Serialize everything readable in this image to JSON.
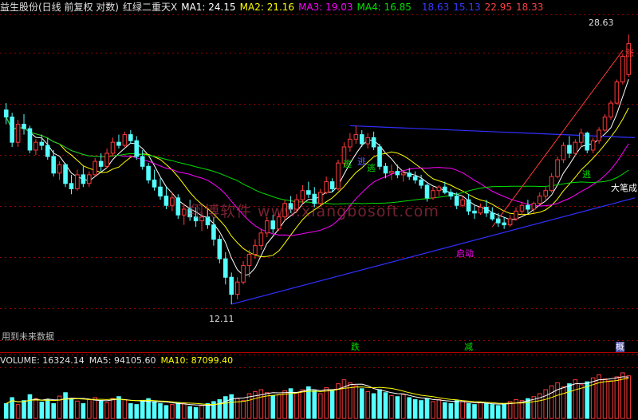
{
  "header": {
    "title": "益生股份(日线 前复权 对数)",
    "indicator": "红绿二重天X",
    "ma1": "MA1: 24.15",
    "ma2": "MA2: 21.16",
    "ma3": "MA3: 19.03",
    "ma4": "MA4: 16.85",
    "v1": "18.63",
    "v2": "15.13",
    "v3": "22.95",
    "v4": "18.33"
  },
  "colors": {
    "background": "#000000",
    "up": "#ff3a3a",
    "down": "#54ffff",
    "ma1": "#ffffff",
    "ma2": "#ffff00",
    "ma3": "#ff00ff",
    "ma4": "#00e000",
    "trendline": "#3030ff",
    "grid": "#9a0000"
  },
  "price_panel": {
    "high_label": "28.63",
    "low_label": "12.11",
    "rise_tag": "涨",
    "future_data_note": "用到未来数据",
    "annotations": [
      "逃",
      "逃",
      "逃",
      "启动",
      "逃",
      "大笔成"
    ]
  },
  "signal_row": {
    "fall": "跌",
    "reduce": "减",
    "right": "概"
  },
  "volume_header": {
    "volume": "VOLUME: 16324.14",
    "ma5": "MA5: 94105.60",
    "ma10": "MA10: 87099.40"
  },
  "watermark": "翔博软件 www.xiangbosoft.com",
  "chart_data": {
    "type": "candlestick",
    "price_range": [
      12.11,
      28.63
    ],
    "candles": [
      [
        22.5,
        23.0,
        21.5,
        22.0
      ],
      [
        22.0,
        22.3,
        20.0,
        20.3
      ],
      [
        20.3,
        21.8,
        20.0,
        21.5
      ],
      [
        21.5,
        22.2,
        20.8,
        21.2
      ],
      [
        21.2,
        21.4,
        19.6,
        19.8
      ],
      [
        19.8,
        20.5,
        19.5,
        20.3
      ],
      [
        20.3,
        20.8,
        19.8,
        20.1
      ],
      [
        20.1,
        20.6,
        19.2,
        19.4
      ],
      [
        19.4,
        19.8,
        18.2,
        18.4
      ],
      [
        18.4,
        19.1,
        18.0,
        18.9
      ],
      [
        18.9,
        19.0,
        17.6,
        17.8
      ],
      [
        17.8,
        18.3,
        17.2,
        17.5
      ],
      [
        17.5,
        18.6,
        17.4,
        18.3
      ],
      [
        18.3,
        18.8,
        17.6,
        17.8
      ],
      [
        17.8,
        18.5,
        17.6,
        18.3
      ],
      [
        18.3,
        19.3,
        18.2,
        19.1
      ],
      [
        19.1,
        19.6,
        18.5,
        18.8
      ],
      [
        18.8,
        19.9,
        18.7,
        19.6
      ],
      [
        19.6,
        20.6,
        19.4,
        20.3
      ],
      [
        20.3,
        20.8,
        19.9,
        20.1
      ],
      [
        20.1,
        21.0,
        20.0,
        20.8
      ],
      [
        20.8,
        21.1,
        20.2,
        20.4
      ],
      [
        20.4,
        20.7,
        19.2,
        19.4
      ],
      [
        19.4,
        19.8,
        18.6,
        18.8
      ],
      [
        18.8,
        19.0,
        17.8,
        18.0
      ],
      [
        18.0,
        18.6,
        17.4,
        17.6
      ],
      [
        17.6,
        18.1,
        16.9,
        17.1
      ],
      [
        17.1,
        17.6,
        16.4,
        16.6
      ],
      [
        16.6,
        17.3,
        16.3,
        17.0
      ],
      [
        17.0,
        17.2,
        15.9,
        16.1
      ],
      [
        16.1,
        16.7,
        15.6,
        16.4
      ],
      [
        16.4,
        16.9,
        15.8,
        16.0
      ],
      [
        16.0,
        16.5,
        15.5,
        15.8
      ],
      [
        15.8,
        16.2,
        15.3,
        16.0
      ],
      [
        16.0,
        16.4,
        15.4,
        15.6
      ],
      [
        15.6,
        16.0,
        14.6,
        14.9
      ],
      [
        14.9,
        15.1,
        13.8,
        14.0
      ],
      [
        14.0,
        14.3,
        12.9,
        13.2
      ],
      [
        13.2,
        13.4,
        12.11,
        12.5
      ],
      [
        12.5,
        13.2,
        12.3,
        13.0
      ],
      [
        13.0,
        13.9,
        12.9,
        13.7
      ],
      [
        13.7,
        14.4,
        13.2,
        14.2
      ],
      [
        14.2,
        14.9,
        14.0,
        14.6
      ],
      [
        14.6,
        15.4,
        14.4,
        15.2
      ],
      [
        15.2,
        16.0,
        15.0,
        15.8
      ],
      [
        15.8,
        16.1,
        15.2,
        15.4
      ],
      [
        15.4,
        16.2,
        15.3,
        16.0
      ],
      [
        16.0,
        16.9,
        15.8,
        16.7
      ],
      [
        16.7,
        17.1,
        16.2,
        16.4
      ],
      [
        16.4,
        17.2,
        16.2,
        16.9
      ],
      [
        16.9,
        17.7,
        16.7,
        17.4
      ],
      [
        17.4,
        17.9,
        17.0,
        17.2
      ],
      [
        17.2,
        17.6,
        16.5,
        16.7
      ],
      [
        16.7,
        17.5,
        16.6,
        17.3
      ],
      [
        17.3,
        18.2,
        17.2,
        17.9
      ],
      [
        17.9,
        18.1,
        17.3,
        17.5
      ],
      [
        17.5,
        19.2,
        17.4,
        19.0
      ],
      [
        19.0,
        20.3,
        18.8,
        20.0
      ],
      [
        20.0,
        20.9,
        19.7,
        20.5
      ],
      [
        20.5,
        21.4,
        20.2,
        20.8
      ],
      [
        20.8,
        21.1,
        20.0,
        20.2
      ],
      [
        20.2,
        20.9,
        19.9,
        20.6
      ],
      [
        20.6,
        21.0,
        19.8,
        20.0
      ],
      [
        20.0,
        20.2,
        18.6,
        18.8
      ],
      [
        18.8,
        19.0,
        18.1,
        18.4
      ],
      [
        18.4,
        18.9,
        18.0,
        18.5
      ],
      [
        18.5,
        18.9,
        18.1,
        18.3
      ],
      [
        18.3,
        18.6,
        17.9,
        18.4
      ],
      [
        18.4,
        18.7,
        18.0,
        18.2
      ],
      [
        18.2,
        18.5,
        17.8,
        18.0
      ],
      [
        18.0,
        18.3,
        17.5,
        17.7
      ],
      [
        17.7,
        17.8,
        16.8,
        17.0
      ],
      [
        17.0,
        17.6,
        16.9,
        17.4
      ],
      [
        17.4,
        17.7,
        17.1,
        17.6
      ],
      [
        17.6,
        17.9,
        17.2,
        17.3
      ],
      [
        17.3,
        17.5,
        16.9,
        17.1
      ],
      [
        17.1,
        17.3,
        16.4,
        16.6
      ],
      [
        16.6,
        17.1,
        16.5,
        16.9
      ],
      [
        16.9,
        17.2,
        16.1,
        16.3
      ],
      [
        16.3,
        16.6,
        15.9,
        16.2
      ],
      [
        16.2,
        16.7,
        16.1,
        16.5
      ],
      [
        16.5,
        16.9,
        16.0,
        16.2
      ],
      [
        16.2,
        16.5,
        15.8,
        15.9
      ],
      [
        15.9,
        16.2,
        15.5,
        15.7
      ],
      [
        15.7,
        16.0,
        15.4,
        15.6
      ],
      [
        15.6,
        16.1,
        15.5,
        15.9
      ],
      [
        15.9,
        16.5,
        15.8,
        16.3
      ],
      [
        16.3,
        16.8,
        16.1,
        16.6
      ],
      [
        16.6,
        16.9,
        16.2,
        16.4
      ],
      [
        16.4,
        16.8,
        16.2,
        16.7
      ],
      [
        16.7,
        17.3,
        16.6,
        17.1
      ],
      [
        17.1,
        17.6,
        16.9,
        17.4
      ],
      [
        17.4,
        18.4,
        17.3,
        18.2
      ],
      [
        18.2,
        19.4,
        18.1,
        19.2
      ],
      [
        19.2,
        20.3,
        19.0,
        20.1
      ],
      [
        20.1,
        20.7,
        19.3,
        19.6
      ],
      [
        19.6,
        20.5,
        19.4,
        20.3
      ],
      [
        20.3,
        21.2,
        20.0,
        20.9
      ],
      [
        20.9,
        21.0,
        19.6,
        19.8
      ],
      [
        19.8,
        20.6,
        19.6,
        20.4
      ],
      [
        20.4,
        21.3,
        20.2,
        21.1
      ],
      [
        21.1,
        22.2,
        21.0,
        22.0
      ],
      [
        22.0,
        23.2,
        21.8,
        23.0
      ],
      [
        23.0,
        24.8,
        22.9,
        24.6
      ],
      [
        24.6,
        26.9,
        24.4,
        26.7
      ],
      [
        25.2,
        28.63,
        25.0,
        27.8
      ]
    ],
    "volume": [
      30,
      42,
      28,
      36,
      48,
      40,
      33,
      38,
      30,
      45,
      52,
      40,
      35,
      30,
      38,
      42,
      36,
      32,
      40,
      44,
      38,
      30,
      28,
      36,
      40,
      34,
      30,
      26,
      28,
      32,
      30,
      24,
      22,
      26,
      30,
      34,
      38,
      44,
      48,
      40,
      36,
      50,
      54,
      58,
      52,
      46,
      48,
      56,
      60,
      52,
      58,
      64,
      56,
      50,
      62,
      58,
      70,
      78,
      72,
      66,
      60,
      54,
      50,
      58,
      52,
      46,
      44,
      48,
      42,
      38,
      36,
      40,
      34,
      38,
      32,
      30,
      36,
      34,
      30,
      28,
      32,
      30,
      28,
      26,
      30,
      34,
      38,
      36,
      40,
      44,
      50,
      58,
      66,
      72,
      64,
      70,
      78,
      68,
      74,
      82,
      88,
      80,
      76,
      84,
      92,
      86
    ]
  }
}
